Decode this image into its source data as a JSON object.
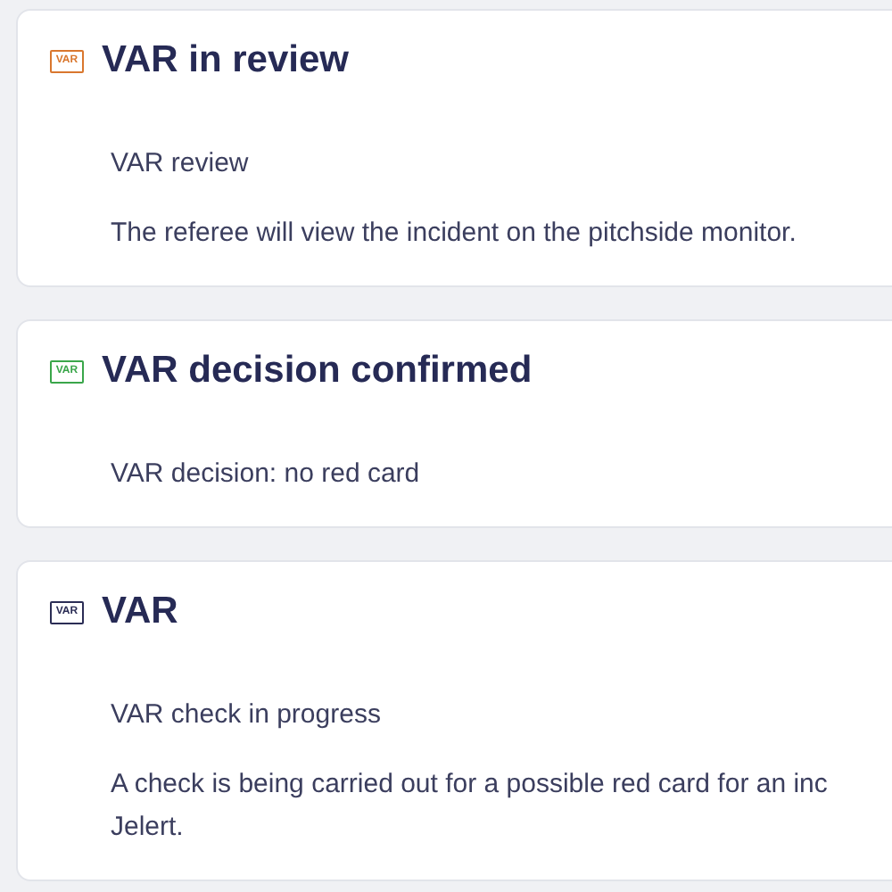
{
  "events": [
    {
      "icon_label": "VAR",
      "color": "#d9772e",
      "title": "VAR in review",
      "paragraphs": [
        [
          "VAR review"
        ],
        [
          "The referee will view the incident on the pitchside monitor."
        ]
      ]
    },
    {
      "icon_label": "VAR",
      "color": "#3aa64a",
      "title": "VAR decision confirmed",
      "paragraphs": [
        [
          "VAR decision: no red card"
        ]
      ]
    },
    {
      "icon_label": "VAR",
      "color": "#2b2d55",
      "title": "VAR",
      "paragraphs": [
        [
          "VAR check in progress"
        ],
        [
          "A check is being carried out for a possible red card for an inc",
          "Jelert."
        ]
      ]
    }
  ]
}
